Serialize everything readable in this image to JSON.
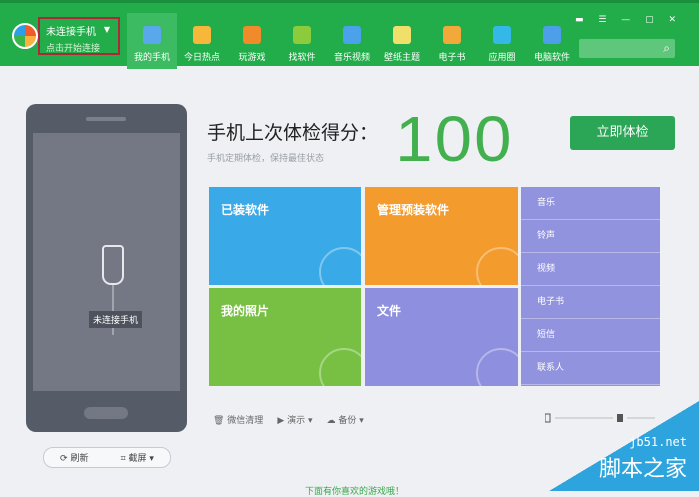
{
  "header": {
    "connect_title": "未连接手机",
    "connect_sub": "点击开始连接",
    "nav": [
      {
        "label": "我的手机",
        "color": "#5aa8ec"
      },
      {
        "label": "今日热点",
        "color": "#f7b73b"
      },
      {
        "label": "玩游戏",
        "color": "#f08a2a"
      },
      {
        "label": "找软件",
        "color": "#8ccc3c"
      },
      {
        "label": "音乐视频",
        "color": "#4aa3ea"
      },
      {
        "label": "壁纸主题",
        "color": "#f0df6a"
      },
      {
        "label": "电子书",
        "color": "#f2a93a"
      },
      {
        "label": "应用圈",
        "color": "#33b8e8"
      },
      {
        "label": "电脑软件",
        "color": "#4c9fe8"
      }
    ],
    "search_placeholder": ""
  },
  "phone": {
    "status": "未连接手机",
    "refresh": "刷新",
    "screenshot": "截屏"
  },
  "check": {
    "title": "手机上次体检得分：",
    "subtitle": "手机定期体检，保持最佳状态",
    "score": "100",
    "button": "立即体检"
  },
  "tiles": [
    {
      "label": "已装软件",
      "color": "#3aa9e7"
    },
    {
      "label": "管理预装软件",
      "color": "#f39b2c"
    },
    {
      "label": "我的照片",
      "color": "#77c043"
    },
    {
      "label": "文件",
      "color": "#8e8fdf"
    }
  ],
  "side_list": [
    "音乐",
    "铃声",
    "视频",
    "电子书",
    "短信",
    "联系人"
  ],
  "tools": {
    "wechat": "微信清理",
    "demo": "演示",
    "backup": "备份"
  },
  "bottom_link": "下面有你喜欢的游戏哦！",
  "watermark": {
    "site": "jb51.net",
    "name": "脚本之家"
  }
}
